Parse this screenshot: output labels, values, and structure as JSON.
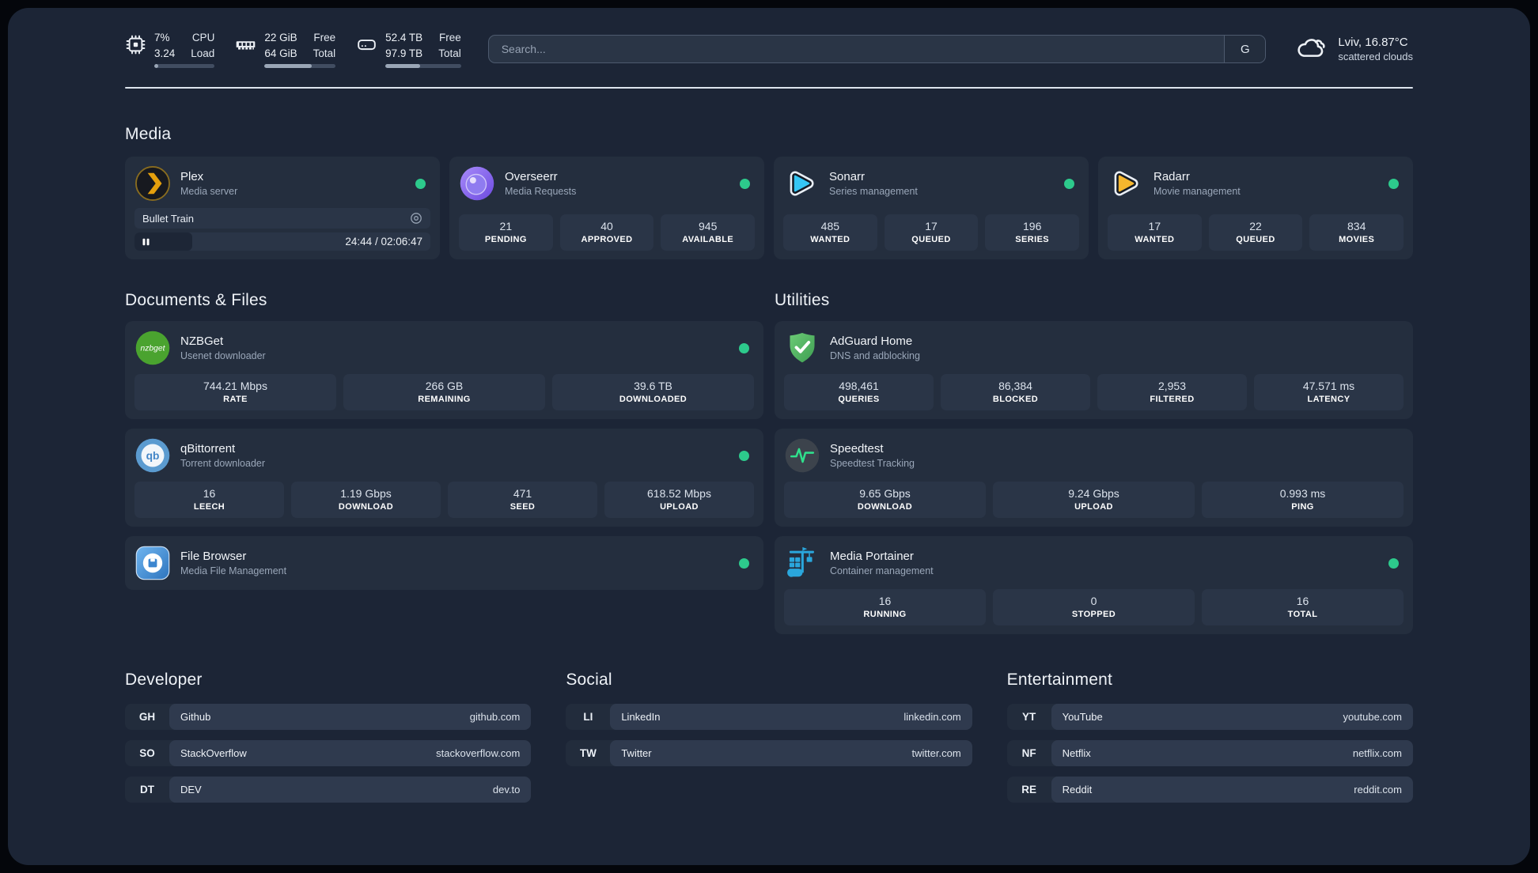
{
  "colors": {
    "status_online": "#2dca8c",
    "plex_brand": "#e5a00d",
    "overseerr_brand": "#8f7cf0",
    "sonarr_brand": "#35c5f4",
    "radarr_brand": "#f5b62e",
    "nzbget_brand": "#4aa32f",
    "qbittorrent_brand": "#5b9bd0",
    "filebrowser_brand": "#3c86cf",
    "adguard_brand": "#55b968",
    "speedtest_pulse": "#2fe08c",
    "portainer_brand": "#2aa7dd"
  },
  "top_bar": {
    "system_stats": [
      {
        "icon": "cpu-icon",
        "value_top": "7%",
        "value_bottom": "3.24",
        "label_top": "CPU",
        "label_bottom": "Load",
        "progress_percent": 7
      },
      {
        "icon": "ram-icon",
        "value_top": "22 GiB",
        "value_bottom": "64 GiB",
        "label_top": "Free",
        "label_bottom": "Total",
        "progress_percent": 66
      },
      {
        "icon": "disk-icon",
        "value_top": "52.4 TB",
        "value_bottom": "97.9 TB",
        "label_top": "Free",
        "label_bottom": "Total",
        "progress_percent": 46
      }
    ],
    "search": {
      "placeholder": "Search...",
      "engine_label": "G"
    },
    "weather": {
      "icon": "cloud-icon",
      "location_temp": "Lviv, 16.87°C",
      "condition": "scattered clouds"
    }
  },
  "sections": {
    "media": {
      "title": "Media",
      "cards": [
        {
          "id": "plex",
          "icon": "plex-icon",
          "name": "Plex",
          "description": "Media server",
          "online": true,
          "media_player": {
            "title": "Bullet Train",
            "time": "24:44 / 02:06:47",
            "progress_percent": 19.5,
            "state": "paused"
          }
        },
        {
          "id": "overseerr",
          "icon": "overseerr-icon",
          "name": "Overseerr",
          "description": "Media Requests",
          "online": true,
          "stats": [
            {
              "value": "21",
              "label": "PENDING"
            },
            {
              "value": "40",
              "label": "APPROVED"
            },
            {
              "value": "945",
              "label": "AVAILABLE"
            }
          ]
        },
        {
          "id": "sonarr",
          "icon": "sonarr-icon",
          "name": "Sonarr",
          "description": "Series management",
          "online": true,
          "stats": [
            {
              "value": "485",
              "label": "WANTED"
            },
            {
              "value": "17",
              "label": "QUEUED"
            },
            {
              "value": "196",
              "label": "SERIES"
            }
          ]
        },
        {
          "id": "radarr",
          "icon": "radarr-icon",
          "name": "Radarr",
          "description": "Movie management",
          "online": true,
          "stats": [
            {
              "value": "17",
              "label": "WANTED"
            },
            {
              "value": "22",
              "label": "QUEUED"
            },
            {
              "value": "834",
              "label": "MOVIES"
            }
          ]
        }
      ]
    },
    "documents": {
      "title": "Documents & Files",
      "cards": [
        {
          "id": "nzbget",
          "icon": "nzbget-icon",
          "name": "NZBGet",
          "description": "Usenet downloader",
          "online": true,
          "stats": [
            {
              "value": "744.21 Mbps",
              "label": "RATE"
            },
            {
              "value": "266 GB",
              "label": "REMAINING"
            },
            {
              "value": "39.6 TB",
              "label": "DOWNLOADED"
            }
          ]
        },
        {
          "id": "qbittorrent",
          "icon": "qbittorrent-icon",
          "name": "qBittorrent",
          "description": "Torrent downloader",
          "online": true,
          "stats": [
            {
              "value": "16",
              "label": "LEECH"
            },
            {
              "value": "1.19 Gbps",
              "label": "DOWNLOAD"
            },
            {
              "value": "471",
              "label": "SEED"
            },
            {
              "value": "618.52 Mbps",
              "label": "UPLOAD"
            }
          ]
        },
        {
          "id": "file-browser",
          "icon": "filebrowser-icon",
          "name": "File Browser",
          "description": "Media File Management",
          "online": true
        }
      ]
    },
    "utilities": {
      "title": "Utilities",
      "cards": [
        {
          "id": "adguard-home",
          "icon": "adguard-icon",
          "name": "AdGuard Home",
          "description": "DNS and adblocking",
          "online": false,
          "stats": [
            {
              "value": "498,461",
              "label": "QUERIES"
            },
            {
              "value": "86,384",
              "label": "BLOCKED"
            },
            {
              "value": "2,953",
              "label": "FILTERED"
            },
            {
              "value": "47.571 ms",
              "label": "LATENCY"
            }
          ]
        },
        {
          "id": "speedtest",
          "icon": "speedtest-icon",
          "name": "Speedtest",
          "description": "Speedtest Tracking",
          "online": false,
          "stats": [
            {
              "value": "9.65 Gbps",
              "label": "DOWNLOAD"
            },
            {
              "value": "9.24 Gbps",
              "label": "UPLOAD"
            },
            {
              "value": "0.993 ms",
              "label": "PING"
            }
          ]
        },
        {
          "id": "media-portainer",
          "icon": "portainer-icon",
          "name": "Media Portainer",
          "description": "Container management",
          "online": true,
          "stats": [
            {
              "value": "16",
              "label": "RUNNING"
            },
            {
              "value": "0",
              "label": "STOPPED"
            },
            {
              "value": "16",
              "label": "TOTAL"
            }
          ]
        }
      ]
    }
  },
  "bookmark_sections": [
    {
      "title": "Developer",
      "links": [
        {
          "abbr": "GH",
          "name": "Github",
          "url": "github.com"
        },
        {
          "abbr": "SO",
          "name": "StackOverflow",
          "url": "stackoverflow.com"
        },
        {
          "abbr": "DT",
          "name": "DEV",
          "url": "dev.to"
        }
      ]
    },
    {
      "title": "Social",
      "links": [
        {
          "abbr": "LI",
          "name": "LinkedIn",
          "url": "linkedin.com"
        },
        {
          "abbr": "TW",
          "name": "Twitter",
          "url": "twitter.com"
        }
      ]
    },
    {
      "title": "Entertainment",
      "links": [
        {
          "abbr": "YT",
          "name": "YouTube",
          "url": "youtube.com"
        },
        {
          "abbr": "NF",
          "name": "Netflix",
          "url": "netflix.com"
        },
        {
          "abbr": "RE",
          "name": "Reddit",
          "url": "reddit.com"
        }
      ]
    }
  ]
}
